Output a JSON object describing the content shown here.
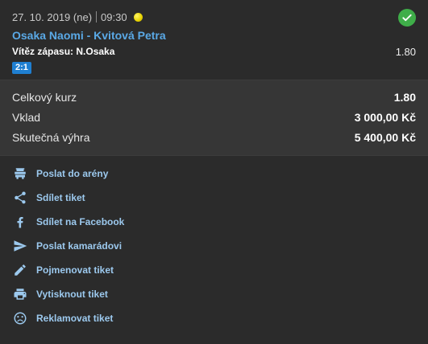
{
  "bet": {
    "date": "27. 10. 2019 (ne)",
    "time": "09:30",
    "match_title": "Osaka Naomi - Kvitová Petra",
    "selection": "Vítěz zápasu: N.Osaka",
    "odd": "1.80",
    "score": "2:1",
    "status_color": "#3fae49"
  },
  "summary": {
    "total_odds_label": "Celkový kurz",
    "total_odds_value": "1.80",
    "stake_label": "Vklad",
    "stake_value": "3 000,00 Kč",
    "win_label": "Skutečná výhra",
    "win_value": "5 400,00 Kč"
  },
  "actions": [
    {
      "label": "Poslat do arény",
      "icon": "arena-icon"
    },
    {
      "label": "Sdílet tiket",
      "icon": "share-icon"
    },
    {
      "label": "Sdílet na Facebook",
      "icon": "facebook-icon"
    },
    {
      "label": "Poslat kamarádovi",
      "icon": "send-icon"
    },
    {
      "label": "Pojmenovat tiket",
      "icon": "pencil-icon"
    },
    {
      "label": "Vytisknout tiket",
      "icon": "printer-icon"
    },
    {
      "label": "Reklamovat tiket",
      "icon": "sad-face-icon"
    }
  ]
}
